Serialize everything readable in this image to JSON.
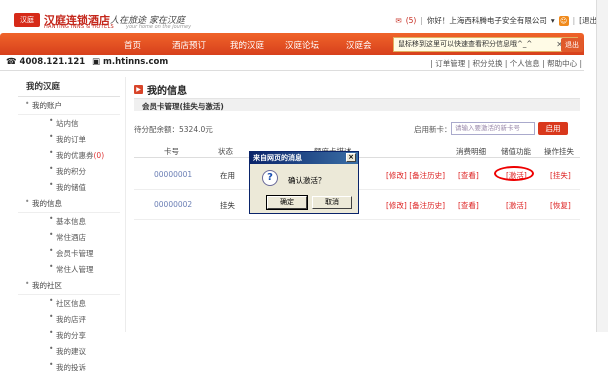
{
  "header": {
    "logo_mark": "汉庭",
    "brand_name": "汉庭连锁酒店",
    "brand_en": "HANTING INNS & HOTELS",
    "slogan": "人在旅途 家在汉庭",
    "slogan_en": "your home on the journey",
    "mail": "(5)",
    "greeting": "你好！上海西科腾电子安全有限公司",
    "logout": "[退出]"
  },
  "nav": {
    "items": [
      "首页",
      "酒店预订",
      "我的汉庭",
      "汉庭论坛",
      "汉庭会"
    ],
    "notify_text": "鼠标移到这里可以快速查看积分信息哦^_^",
    "logout_btn": "退出"
  },
  "contact": {
    "phone": "4008.121.121",
    "website": "m.htinns.com",
    "quicklinks": "| 订单管理 | 积分兑换 | 个人信息 | 帮助中心 |"
  },
  "sidebar": {
    "title": "我的汉庭",
    "groups": [
      {
        "label": "我的账户",
        "items": [
          "站内信",
          "我的订单",
          "我的优惠券",
          "我的积分",
          "我的储值"
        ]
      },
      {
        "label": "我的信息",
        "items": [
          "基本信息",
          "常住酒店",
          "会员卡管理",
          "常住人管理"
        ]
      },
      {
        "label": "我的社区",
        "items": [
          "社区信息",
          "我的店评",
          "我的分享",
          "我的建议",
          "我的投诉"
        ]
      }
    ],
    "coupon_count": "(0)"
  },
  "main": {
    "title": "我的信息",
    "section": "会员卡管理(挂失与激活)",
    "balance": "待分配余额：5324.0元",
    "enable_label": "启用新卡：",
    "card_placeholder": "请输入要激活的新卡号",
    "enable_btn": "启用",
    "columns": [
      "卡号",
      "状态",
      "额度卡描述",
      "消费明细",
      "储值功能",
      "操作挂失"
    ],
    "rows": [
      {
        "card": "00000001",
        "status": "在用",
        "actions": "[修改]  [备注历史]",
        "detail": "[查看]",
        "stored": "[激活]",
        "op": "[挂失]"
      },
      {
        "card": "00000002",
        "status": "挂失",
        "actions": "[修改]  [备注历史]",
        "detail": "[查看]",
        "stored": "[激活]",
        "op": "[恢复]"
      }
    ]
  },
  "dialog": {
    "title": "来自网页的消息",
    "message": "确认激活？",
    "ok": "确定",
    "cancel": "取消"
  }
}
